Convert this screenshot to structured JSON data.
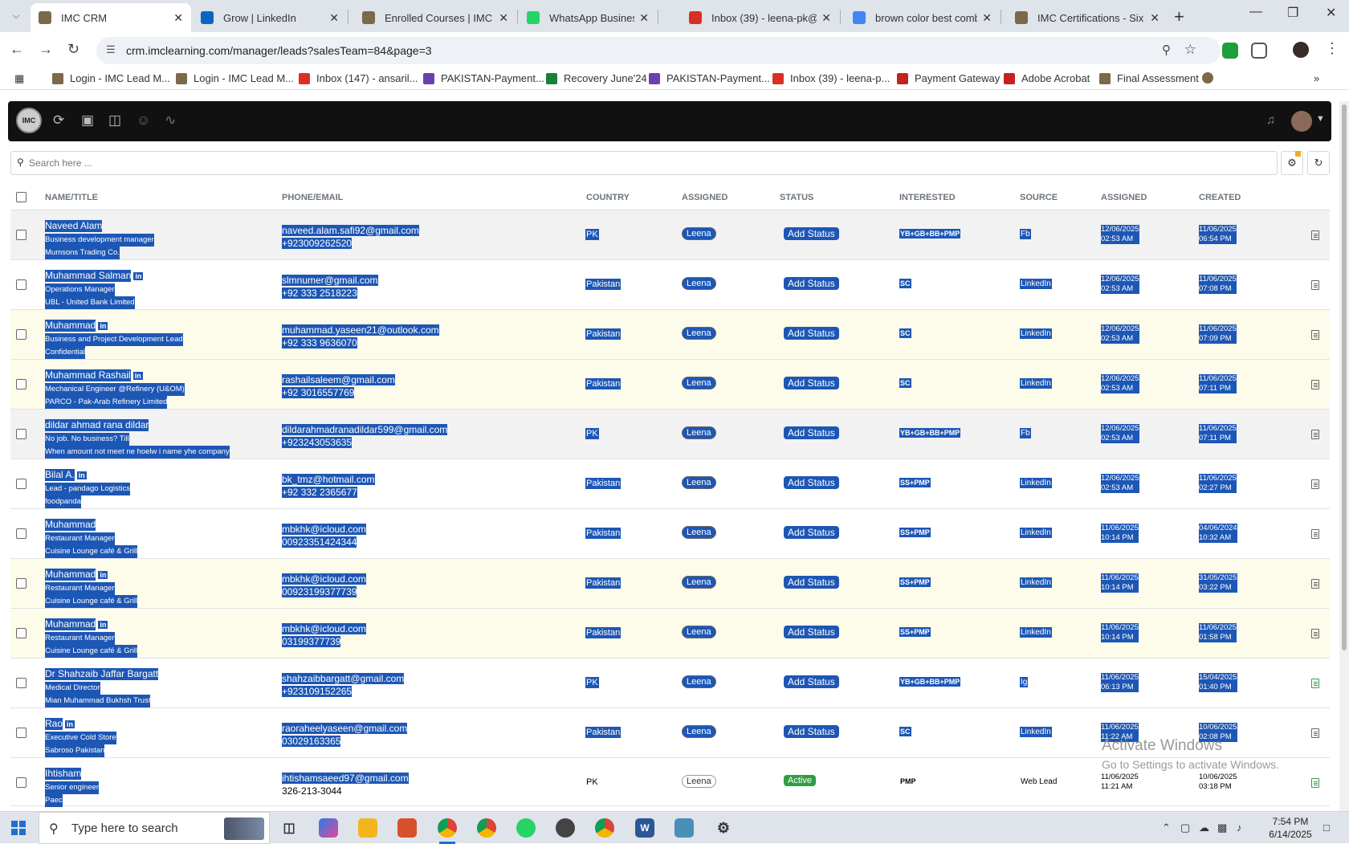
{
  "browser": {
    "tabs": [
      {
        "title": "IMC CRM",
        "icon": "imc-icon",
        "color": "#7a6a4a",
        "active": true
      },
      {
        "title": "Grow | LinkedIn",
        "icon": "linkedin-icon",
        "color": "#0a66c2"
      },
      {
        "title": "Enrolled Courses | IMC C",
        "icon": "imc-icon",
        "color": "#7a6a4a"
      },
      {
        "title": "WhatsApp Business",
        "icon": "whatsapp-icon",
        "color": "#25d366"
      },
      {
        "title": "Inbox (39) - leena-pk@in",
        "icon": "gmail-icon",
        "color": "#d93025"
      },
      {
        "title": "brown color best combo",
        "icon": "google-icon",
        "color": "#4285f4"
      },
      {
        "title": "IMC Certifications - Six Si",
        "icon": "imc-icon",
        "color": "#7a6a4a"
      }
    ],
    "url": "crm.imclearning.com/manager/leads?salesTeam=84&page=3",
    "bookmarks": [
      {
        "label": "Login - IMC Lead M...",
        "color": "#7a6a4a"
      },
      {
        "label": "Login - IMC Lead M...",
        "color": "#7a6a4a"
      },
      {
        "label": "Inbox (147) - ansaril...",
        "color": "#d93025"
      },
      {
        "label": "PAKISTAN-Payment...",
        "color": "#6a3fb0"
      },
      {
        "label": "Recovery June'24",
        "color": "#188038"
      },
      {
        "label": "PAKISTAN-Payment...",
        "color": "#6a3fb0"
      },
      {
        "label": "Inbox (39) - leena-p...",
        "color": "#d93025"
      },
      {
        "label": "Payment Gateway",
        "color": "#c5221f"
      },
      {
        "label": "Adobe Acrobat",
        "color": "#c5221f"
      },
      {
        "label": "Final Assessment",
        "color": "#7a6a4a"
      }
    ]
  },
  "crm": {
    "logo": "IMC",
    "search_placeholder": "Search here ...",
    "columns": {
      "name": "NAME/TITLE",
      "phone": "PHONE/EMAIL",
      "country": "COUNTRY",
      "assigned": "ASSIGNED",
      "status": "STATUS",
      "interested": "INTERESTED",
      "source": "SOURCE",
      "assigned_date": "ASSIGNED",
      "created": "CREATED"
    },
    "linkedin_badge": "in",
    "rows": [
      {
        "name": "Naveed Alam",
        "title": "Business development manager",
        "company": "Mumsons Trading Co.",
        "li": false,
        "email": "naveed.alam.safi92@gmail.com",
        "phone": "+923009262520",
        "country": "PK",
        "assigned": "Leena",
        "status": "Add Status",
        "interested": "YB+GB+BB+PMP",
        "source": "Fb",
        "assigned_date": "12/06/2025",
        "assigned_time": "02:53 AM",
        "created_date": "11/06/2025",
        "created_time": "06:54 PM",
        "bg": "grey"
      },
      {
        "name": "Muhammad Salman",
        "title": "Operations Manager",
        "company": "UBL - United Bank Limited",
        "li": true,
        "email": "slmnumer@gmail.com",
        "phone": "+92 333 2518223",
        "country": "Pakistan",
        "assigned": "Leena",
        "status": "Add Status",
        "interested": "SC",
        "source": "LinkedIn",
        "assigned_date": "12/06/2025",
        "assigned_time": "02:53 AM",
        "created_date": "11/06/2025",
        "created_time": "07:08 PM",
        "bg": "white"
      },
      {
        "name": "Muhammad",
        "title": "Business and Project Development Lead",
        "company": "Confidential",
        "li": true,
        "email": "muhammad.yaseen21@outlook.com",
        "phone": "+92 333 9636070",
        "country": "Pakistan",
        "assigned": "Leena",
        "status": "Add Status",
        "interested": "SC",
        "source": "LinkedIn",
        "assigned_date": "12/06/2025",
        "assigned_time": "02:53 AM",
        "created_date": "11/06/2025",
        "created_time": "07:09 PM",
        "bg": "yellow"
      },
      {
        "name": "Muhammad Rashail",
        "title": "Mechanical Engineer @Refinery (U&OM)",
        "company": "PARCO - Pak-Arab Refinery Limited",
        "li": true,
        "email": "rashailsaleem@gmail.com",
        "phone": "+92 3016557769",
        "country": "Pakistan",
        "assigned": "Leena",
        "status": "Add Status",
        "interested": "SC",
        "source": "LinkedIn",
        "assigned_date": "12/06/2025",
        "assigned_time": "02:53 AM",
        "created_date": "11/06/2025",
        "created_time": "07:11 PM",
        "bg": "yellow"
      },
      {
        "name": "dildar ahmad rana dildar",
        "title": "No job. No business? Till",
        "company": "When amount not meet ne hoelw i name yhe company",
        "li": false,
        "email": "dildarahmadranadildar599@gmail.com",
        "phone": "+923243053635",
        "country": "PK",
        "assigned": "Leena",
        "status": "Add Status",
        "interested": "YB+GB+BB+PMP",
        "source": "Fb",
        "assigned_date": "12/06/2025",
        "assigned_time": "02:53 AM",
        "created_date": "11/06/2025",
        "created_time": "07:11 PM",
        "bg": "grey"
      },
      {
        "name": "Bilal A.",
        "title": "Lead - pandago Logistics",
        "company": "foodpanda",
        "li": true,
        "email": "bk_tmz@hotmail.com",
        "phone": "+92 332 2365677",
        "country": "Pakistan",
        "assigned": "Leena",
        "status": "Add Status",
        "interested": "SS+PMP",
        "source": "LinkedIn",
        "assigned_date": "12/06/2025",
        "assigned_time": "02:53 AM",
        "created_date": "11/06/2025",
        "created_time": "02:27 PM",
        "bg": "white"
      },
      {
        "name": "Muhammad",
        "title": "Restaurant Manager",
        "company": "Cuisine Lounge café & Grill",
        "li": false,
        "email": "mbkhk@icloud.com",
        "phone": "00923351424344",
        "country": "Pakistan",
        "assigned": "Leena",
        "status": "Add Status",
        "interested": "SS+PMP",
        "source": "LinkedIn",
        "assigned_date": "11/06/2025",
        "assigned_time": "10:14 PM",
        "created_date": "04/06/2024",
        "created_time": "10:32 AM",
        "bg": "white"
      },
      {
        "name": "Muhammad",
        "title": "Restaurant Manager",
        "company": "Cuisine Lounge café & Grill",
        "li": true,
        "email": "mbkhk@icloud.com",
        "phone": "00923199377739",
        "country": "Pakistan",
        "assigned": "Leena",
        "status": "Add Status",
        "interested": "SS+PMP",
        "source": "LinkedIn",
        "assigned_date": "11/06/2025",
        "assigned_time": "10:14 PM",
        "created_date": "31/05/2025",
        "created_time": "03:22 PM",
        "bg": "yellow"
      },
      {
        "name": "Muhammad",
        "title": "Restaurant Manager",
        "company": "Cuisine Lounge café & Grill",
        "li": true,
        "email": "mbkhk@icloud.com",
        "phone": "03199377739",
        "country": "Pakistan",
        "assigned": "Leena",
        "status": "Add Status",
        "interested": "SS+PMP",
        "source": "LinkedIn",
        "assigned_date": "11/06/2025",
        "assigned_time": "10:14 PM",
        "created_date": "11/06/2025",
        "created_time": "01:58 PM",
        "bg": "yellow"
      },
      {
        "name": "Dr Shahzaib Jaffar Bargatt",
        "title": "Medical Director",
        "company": "Mian Muhammad Bukhsh Trust",
        "li": false,
        "email": "shahzaibbargatt@gmail.com",
        "phone": "+923109152265",
        "country": "PK",
        "assigned": "Leena",
        "status": "Add Status",
        "interested": "YB+GB+BB+PMP",
        "source": "Ig",
        "assigned_date": "11/06/2025",
        "assigned_time": "06:13 PM",
        "created_date": "15/04/2025",
        "created_time": "01:40 PM",
        "bg": "white",
        "doc_green": true
      },
      {
        "name": "Rao",
        "title": "Executive Cold Store",
        "company": "Sabroso Pakistan",
        "li": true,
        "email": "raoraheelyaseen@gmail.com",
        "phone": "03029163365",
        "country": "Pakistan",
        "assigned": "Leena",
        "status": "Add Status",
        "interested": "SC",
        "source": "LinkedIn",
        "assigned_date": "11/06/2025",
        "assigned_time": "11:22 AM",
        "created_date": "10/06/2025",
        "created_time": "02:08 PM",
        "bg": "white"
      },
      {
        "name": "Ihtisham",
        "title": "Senior engineer",
        "company": "Paec",
        "li": false,
        "email": "ihtishamsaeed97@gmail.com",
        "phone": "326-213-3044",
        "country": "PK",
        "assigned": "Leena",
        "status": "Active",
        "interested": "PMP",
        "source": "Web Lead",
        "assigned_date": "11/06/2025",
        "assigned_time": "11:21 AM",
        "created_date": "10/06/2025",
        "created_time": "03:18 PM",
        "bg": "white",
        "partial": true,
        "doc_green": true
      }
    ]
  },
  "watermark": {
    "title": "Activate Windows",
    "subtitle": "Go to Settings to activate Windows."
  },
  "taskbar": {
    "search_placeholder": "Type here to search",
    "time": "7:54 PM",
    "date": "6/14/2025",
    "accent": "#1f6fd1"
  }
}
